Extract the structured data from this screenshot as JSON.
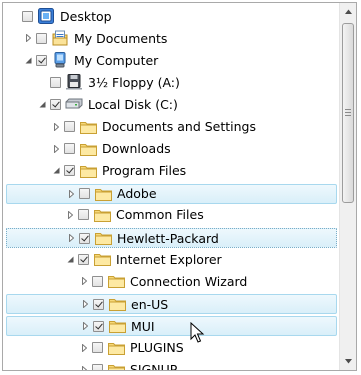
{
  "tree": {
    "items": [
      {
        "label": "Desktop",
        "depth": 0,
        "arrow": "none",
        "checked": false,
        "icon": "desktop-icon",
        "state": ""
      },
      {
        "label": "My Documents",
        "depth": 1,
        "arrow": "collapsed",
        "checked": false,
        "icon": "documents-icon",
        "state": ""
      },
      {
        "label": "My Computer",
        "depth": 1,
        "arrow": "expanded",
        "checked": true,
        "icon": "computer-icon",
        "state": ""
      },
      {
        "label": "3½ Floppy (A:)",
        "depth": 2,
        "arrow": "none",
        "checked": false,
        "icon": "floppy-icon",
        "state": ""
      },
      {
        "label": "Local Disk (C:)",
        "depth": 2,
        "arrow": "expanded",
        "checked": true,
        "icon": "disk-icon",
        "state": ""
      },
      {
        "label": "Documents and Settings",
        "depth": 3,
        "arrow": "collapsed",
        "checked": false,
        "icon": "folder-icon",
        "state": ""
      },
      {
        "label": "Downloads",
        "depth": 3,
        "arrow": "collapsed",
        "checked": false,
        "icon": "folder-icon",
        "state": ""
      },
      {
        "label": "Program Files",
        "depth": 3,
        "arrow": "expanded",
        "checked": true,
        "icon": "folder-icon",
        "state": ""
      },
      {
        "label": "Adobe",
        "depth": 4,
        "arrow": "collapsed",
        "checked": false,
        "icon": "folder-icon",
        "state": "selected"
      },
      {
        "label": "Common Files",
        "depth": 4,
        "arrow": "collapsed",
        "checked": false,
        "icon": "folder-icon",
        "state": ""
      },
      {
        "label": "Hewlett-Packard",
        "depth": 4,
        "arrow": "collapsed",
        "checked": true,
        "icon": "folder-icon",
        "state": "focused"
      },
      {
        "label": "Internet Explorer",
        "depth": 4,
        "arrow": "expanded",
        "checked": true,
        "icon": "folder-icon",
        "state": ""
      },
      {
        "label": "Connection Wizard",
        "depth": 5,
        "arrow": "collapsed",
        "checked": false,
        "icon": "folder-icon",
        "state": ""
      },
      {
        "label": "en-US",
        "depth": 5,
        "arrow": "collapsed",
        "checked": true,
        "icon": "folder-icon",
        "state": "selected"
      },
      {
        "label": "MUI",
        "depth": 5,
        "arrow": "collapsed",
        "checked": true,
        "icon": "folder-icon",
        "state": "selected"
      },
      {
        "label": "PLUGINS",
        "depth": 5,
        "arrow": "collapsed",
        "checked": false,
        "icon": "folder-icon",
        "state": ""
      },
      {
        "label": "SIGNUP",
        "depth": 5,
        "arrow": "collapsed",
        "checked": false,
        "icon": "folder-icon",
        "state": ""
      }
    ]
  },
  "scrollbar": {
    "up_icon": "scroll-up-arrow-icon",
    "down_icon": "scroll-down-arrow-icon"
  },
  "colors": {
    "selection_fill": "#d9eff9",
    "selection_border": "#a8d8ee",
    "folder": "#f2cd5c"
  }
}
